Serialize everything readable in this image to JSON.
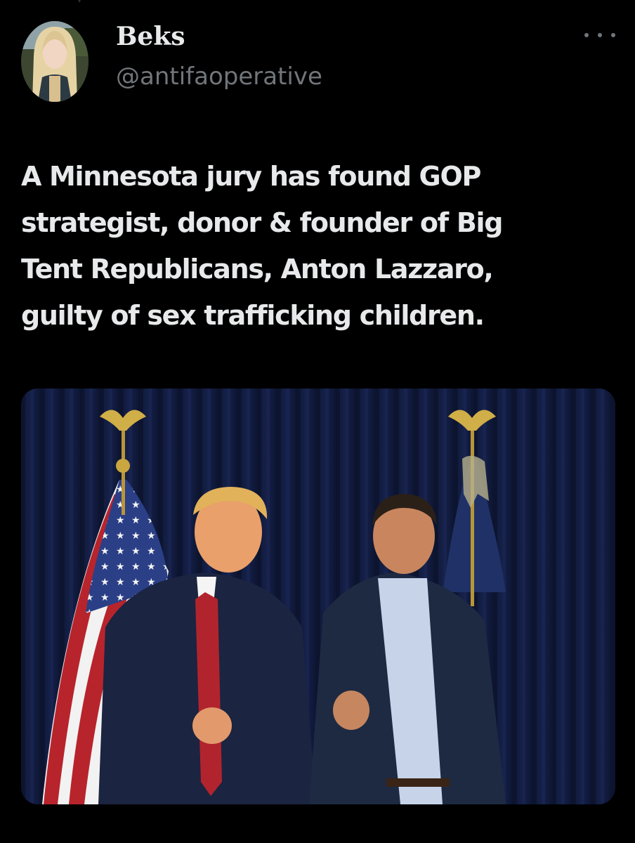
{
  "tweet": {
    "author": {
      "display_name": "Beks",
      "handle": "@antifaoperative"
    },
    "more_icon": "more-horizontal-icon",
    "text_lines": [
      "A Minnesota jury has found GOP",
      "strategist, donor & founder of Big",
      "Tent Republicans, Anton Lazzaro,",
      "guilty of sex trafficking children."
    ],
    "media": {
      "type": "photo"
    }
  },
  "colors": {
    "background": "#000000",
    "text_primary": "#e7e9ea",
    "text_secondary": "#71767b"
  }
}
